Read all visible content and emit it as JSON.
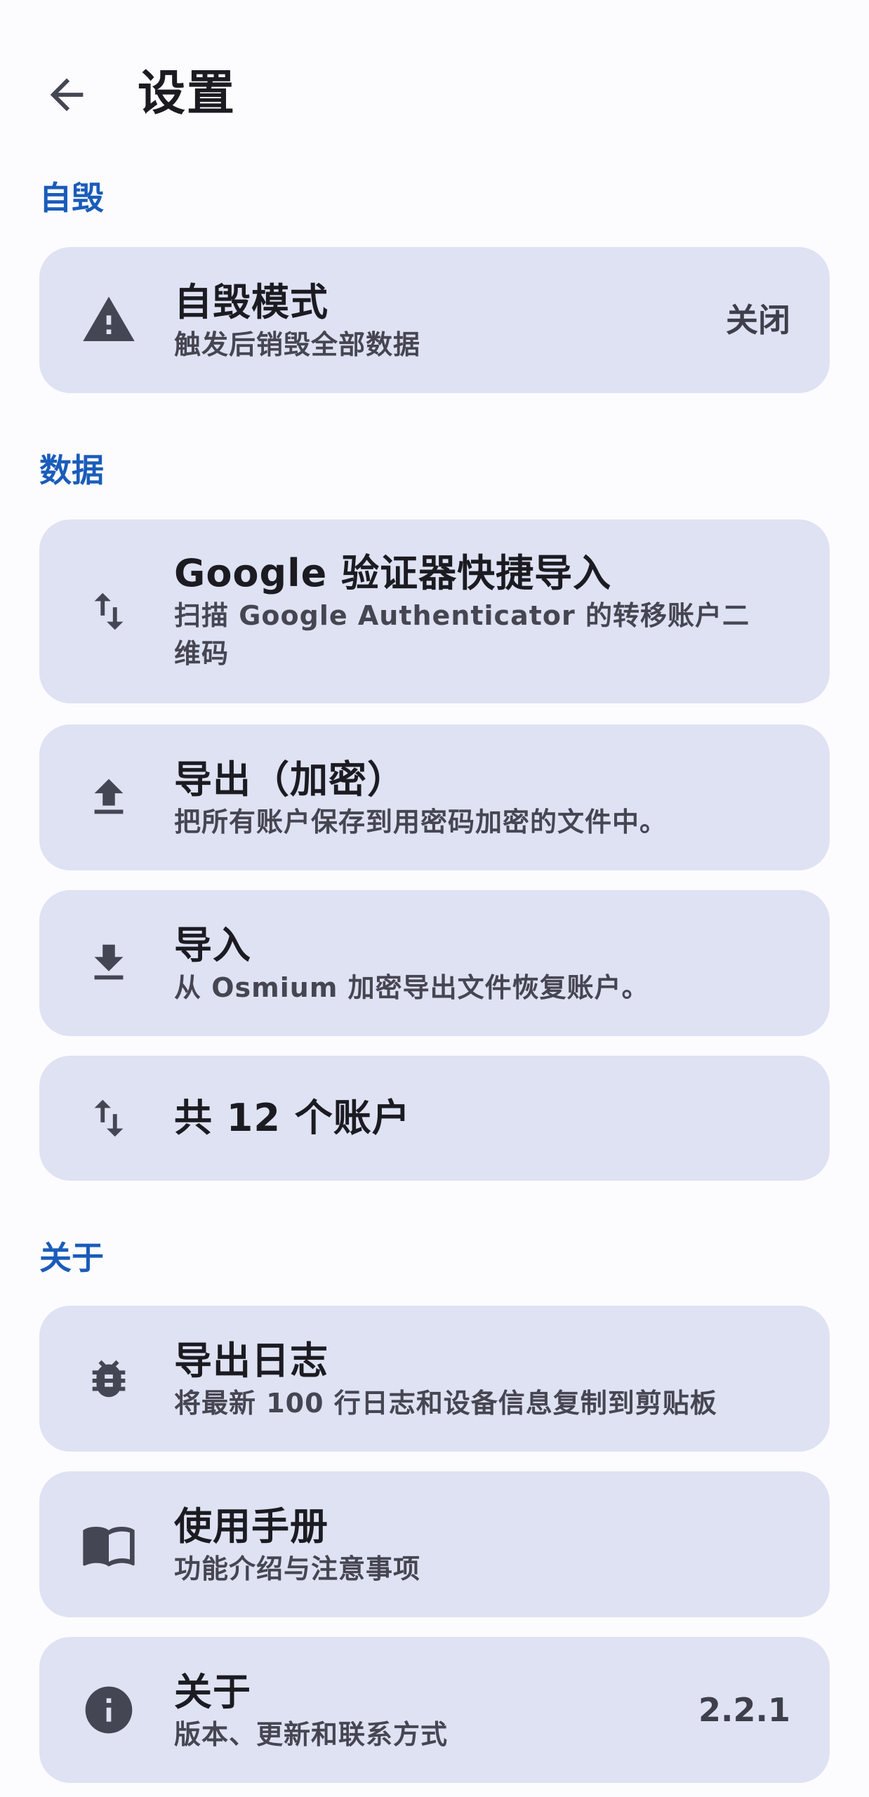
{
  "header": {
    "title": "设置"
  },
  "sections": {
    "self_destruct": "自毁",
    "data": "数据",
    "about": "关于"
  },
  "items": {
    "self_destruct_mode": {
      "title": "自毁模式",
      "subtitle": "触发后销毁全部数据",
      "value": "关闭",
      "icon": "warning-icon"
    },
    "google_import": {
      "title": "Google 验证器快捷导入",
      "subtitle": "扫描 Google Authenticator 的转移账户二维码",
      "icon": "swap-vert-icon"
    },
    "export_encrypted": {
      "title": "导出（加密）",
      "subtitle": "把所有账户保存到用密码加密的文件中。",
      "icon": "upload-icon"
    },
    "import": {
      "title": "导入",
      "subtitle": "从 Osmium 加密导出文件恢复账户。",
      "icon": "download-icon"
    },
    "account_count": {
      "title": "共 12 个账户",
      "icon": "swap-vert-icon"
    },
    "export_logs": {
      "title": "导出日志",
      "subtitle": "将最新 100 行日志和设备信息复制到剪贴板",
      "icon": "bug-icon"
    },
    "manual": {
      "title": "使用手册",
      "subtitle": "功能介绍与注意事项",
      "icon": "book-icon"
    },
    "about": {
      "title": "关于",
      "subtitle": "版本、更新和联系方式",
      "value": "2.2.1",
      "icon": "info-icon"
    }
  },
  "colors": {
    "background": "#fcfbfe",
    "card": "#dee2f3",
    "section_header": "#1a5cba",
    "icon": "#454654"
  }
}
